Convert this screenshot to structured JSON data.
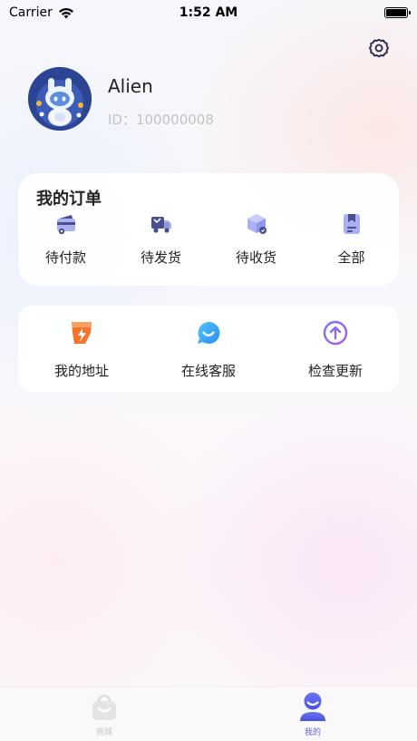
{
  "status_bar": {
    "carrier": "Carrier",
    "time": "1:52 AM"
  },
  "profile": {
    "name": "Alien",
    "id_text": "ID：100000008"
  },
  "orders": {
    "title": "我的订单",
    "items": [
      {
        "label": "待付款",
        "icon": "wallet-icon"
      },
      {
        "label": "待发货",
        "icon": "truck-icon"
      },
      {
        "label": "待收货",
        "icon": "package-icon"
      },
      {
        "label": "全部",
        "icon": "document-icon"
      }
    ]
  },
  "tools": {
    "items": [
      {
        "label": "我的地址",
        "icon": "address-icon"
      },
      {
        "label": "在线客服",
        "icon": "chat-icon"
      },
      {
        "label": "检查更新",
        "icon": "update-arrow-icon"
      }
    ]
  },
  "tab_bar": {
    "items": [
      {
        "label": "商城",
        "icon": "shopping-bag-icon",
        "active": false
      },
      {
        "label": "我的",
        "icon": "person-icon",
        "active": true
      }
    ]
  },
  "colors": {
    "accent": "#5b63e8",
    "icon_dark": "#4a4f8f",
    "icon_light": "#a9b0f3",
    "orange": "#f5732a"
  }
}
